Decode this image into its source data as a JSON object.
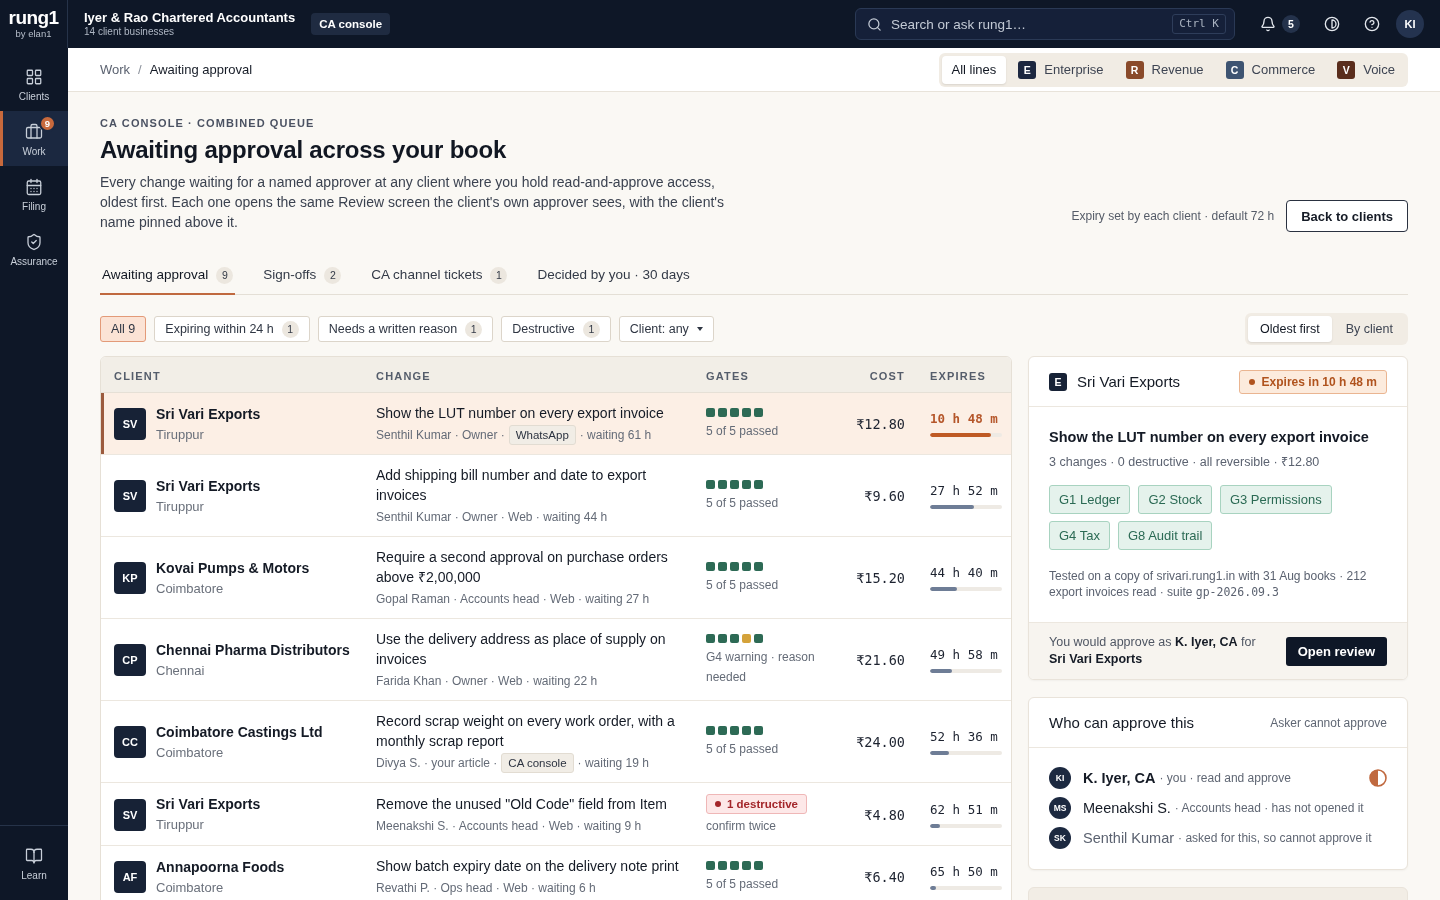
{
  "top_bar": {
    "logo": "rung1",
    "logo_sub": "by elan1",
    "firm": "Iyer & Rao Chartered Accountants",
    "firm_sub": "14 client businesses",
    "console_badge": "CA console",
    "search": {
      "placeholder": "Search or ask rung1…",
      "shortcut": "Ctrl K"
    },
    "notifications": "5",
    "avatar": "KI"
  },
  "sidebar": {
    "items": [
      {
        "label": "Clients",
        "selected": false
      },
      {
        "label": "Work",
        "selected": true,
        "badge": "9"
      },
      {
        "label": "Filing",
        "selected": false
      },
      {
        "label": "Assurance",
        "selected": false
      }
    ],
    "footer": {
      "label": "Learn"
    }
  },
  "breadcrumb": {
    "items": [
      "Work",
      "Awaiting approval"
    ],
    "separator": "/"
  },
  "lines": [
    {
      "label": "All lines",
      "selected": true
    },
    {
      "label": "Enterprise",
      "tile": "E",
      "color": "#1c2740",
      "selected": false
    },
    {
      "label": "Revenue",
      "tile": "R",
      "color": "#8a4a2a",
      "selected": false
    },
    {
      "label": "Commerce",
      "tile": "C",
      "color": "#3e5472",
      "selected": false
    },
    {
      "label": "Voice",
      "tile": "V",
      "color": "#5a2d1c",
      "selected": false
    }
  ],
  "header": {
    "eyebrow": "CA CONSOLE · COMBINED QUEUE",
    "title": "Awaiting approval across your book",
    "description": "Every change waiting for a named approver at any client where you hold read-and-approve access, oldest first. Each one opens the same Review screen the client's own approver sees, with the client's name pinned above it.",
    "expiry_note": "Expiry set by each client · default 72 h",
    "back_button": "Back to clients"
  },
  "tabs": [
    {
      "label": "Awaiting approval",
      "count": "9",
      "selected": true
    },
    {
      "label": "Sign-offs",
      "count": "2",
      "selected": false
    },
    {
      "label": "CA channel tickets",
      "count": "1",
      "selected": false
    },
    {
      "label": "Decided by you · 30 days",
      "selected": false
    }
  ],
  "filters": [
    {
      "kind": "chip",
      "label": "All 9",
      "selected": true
    },
    {
      "kind": "chip",
      "label": "Expiring within 24 h",
      "count": "1",
      "selected": false
    },
    {
      "kind": "chip",
      "label": "Needs a written reason",
      "count": "1",
      "selected": false
    },
    {
      "kind": "chip",
      "label": "Destructive",
      "count": "1",
      "selected": false
    },
    {
      "kind": "dropdown",
      "label": "Client: any",
      "selected": false
    }
  ],
  "sort": [
    {
      "label": "Oldest first",
      "selected": true
    },
    {
      "label": "By client",
      "selected": false
    }
  ],
  "table": {
    "columns": [
      "CLIENT",
      "CHANGE",
      "GATES",
      "COST",
      "EXPIRES"
    ],
    "rows": [
      {
        "initials": "SV",
        "client": "Sri Vari Exports",
        "city": "Tiruppur",
        "title": "Show the LUT number on every export invoice",
        "meta": [
          {
            "kind": "text",
            "text": "Senthil Kumar · Owner ·"
          },
          {
            "kind": "tag",
            "text": "WhatsApp"
          },
          {
            "kind": "text",
            "text": "· waiting 61 h"
          }
        ],
        "gates": {
          "kind": "squares",
          "squares": [
            {
              "color": "#2d6a55"
            },
            {
              "color": "#2d6a55"
            },
            {
              "color": "#2d6a55"
            },
            {
              "color": "#2d6a55"
            },
            {
              "color": "#2d6a55"
            }
          ],
          "note": "5 of 5 passed"
        },
        "cost": "₹12.80",
        "expires": "10 h 48 m",
        "level": 0.85,
        "urgent": true,
        "selected": true
      },
      {
        "initials": "SV",
        "client": "Sri Vari Exports",
        "city": "Tiruppur",
        "title": "Add shipping bill number and date to export invoices",
        "meta": [
          {
            "kind": "text",
            "text": "Senthil Kumar · Owner · Web · waiting 44 h"
          }
        ],
        "gates": {
          "kind": "squares",
          "squares": [
            {
              "color": "#2d6a55"
            },
            {
              "color": "#2d6a55"
            },
            {
              "color": "#2d6a55"
            },
            {
              "color": "#2d6a55"
            },
            {
              "color": "#2d6a55"
            }
          ],
          "note": "5 of 5 passed"
        },
        "cost": "₹9.60",
        "expires": "27 h 52 m",
        "level": 0.61,
        "urgent": false,
        "selected": false
      },
      {
        "initials": "KP",
        "client": "Kovai Pumps & Motors",
        "city": "Coimbatore",
        "title": "Require a second approval on purchase orders above ₹2,00,000",
        "meta": [
          {
            "kind": "text",
            "text": "Gopal Raman · Accounts head · Web · waiting 27 h"
          }
        ],
        "gates": {
          "kind": "squares",
          "squares": [
            {
              "color": "#2d6a55"
            },
            {
              "color": "#2d6a55"
            },
            {
              "color": "#2d6a55"
            },
            {
              "color": "#2d6a55"
            },
            {
              "color": "#2d6a55"
            }
          ],
          "note": "5 of 5 passed"
        },
        "cost": "₹15.20",
        "expires": "44 h 40 m",
        "level": 0.38,
        "urgent": false,
        "selected": false
      },
      {
        "initials": "CP",
        "client": "Chennai Pharma Distributors",
        "city": "Chennai",
        "title": "Use the delivery address as place of supply on invoices",
        "meta": [
          {
            "kind": "text",
            "text": "Farida Khan · Owner · Web · waiting 22 h"
          }
        ],
        "gates": {
          "kind": "squares",
          "squares": [
            {
              "color": "#2d6a55"
            },
            {
              "color": "#2d6a55"
            },
            {
              "color": "#2d6a55"
            },
            {
              "color": "#d4a23a"
            },
            {
              "color": "#2d6a55"
            }
          ],
          "note": "G4 warning · reason needed"
        },
        "cost": "₹21.60",
        "expires": "49 h 58 m",
        "level": 0.31,
        "urgent": false,
        "selected": false
      },
      {
        "initials": "CC",
        "client": "Coimbatore Castings Ltd",
        "city": "Coimbatore",
        "title": "Record scrap weight on every work order, with a monthly scrap report",
        "meta": [
          {
            "kind": "text",
            "text": "Divya S. · your article ·"
          },
          {
            "kind": "tag",
            "text": "CA console"
          },
          {
            "kind": "text",
            "text": "· waiting 19 h"
          }
        ],
        "gates": {
          "kind": "squares",
          "squares": [
            {
              "color": "#2d6a55"
            },
            {
              "color": "#2d6a55"
            },
            {
              "color": "#2d6a55"
            },
            {
              "color": "#2d6a55"
            },
            {
              "color": "#2d6a55"
            }
          ],
          "note": "5 of 5 passed"
        },
        "cost": "₹24.00",
        "expires": "52 h 36 m",
        "level": 0.27,
        "urgent": false,
        "selected": false
      },
      {
        "initials": "SV",
        "client": "Sri Vari Exports",
        "city": "Tiruppur",
        "title": "Remove the unused \"Old Code\" field from Item",
        "meta": [
          {
            "kind": "text",
            "text": "Meenakshi S. · Accounts head · Web · waiting 9 h"
          }
        ],
        "gates": {
          "kind": "badge",
          "badge": "1 destructive",
          "note": "confirm twice"
        },
        "cost": "₹4.80",
        "expires": "62 h 51 m",
        "level": 0.14,
        "urgent": false,
        "selected": false
      },
      {
        "initials": "AF",
        "client": "Annapoorna Foods",
        "city": "Coimbatore",
        "title": "Show batch expiry date on the delivery note print",
        "meta": [
          {
            "kind": "text",
            "text": "Revathi P. · Ops head · Web · waiting 6 h"
          }
        ],
        "gates": {
          "kind": "squares",
          "squares": [
            {
              "color": "#2d6a55"
            },
            {
              "color": "#2d6a55"
            },
            {
              "color": "#2d6a55"
            },
            {
              "color": "#2d6a55"
            },
            {
              "color": "#2d6a55"
            }
          ],
          "note": "5 of 5 passed"
        },
        "cost": "₹6.40",
        "expires": "65 h 50 m",
        "level": 0.08,
        "urgent": false,
        "selected": false
      }
    ]
  },
  "detail": {
    "tile": "E",
    "client": "Sri Vari Exports",
    "expires_badge": "Expires in 10 h 48 m",
    "title": "Show the LUT number on every export invoice",
    "meta": "3 changes · 0 destructive · all reversible · ₹12.80",
    "gates": [
      "G1 Ledger",
      "G2 Stock",
      "G3 Permissions",
      "G4 Tax",
      "G8 Audit trail"
    ],
    "test_note": {
      "text": "Tested on a copy of srivari.rung1.in with 31 Aug books · 212 export invoices read · suite ",
      "code": "gp-2026.09.3"
    },
    "approve_note": "You would approve as **K. Iyer, CA** for **Sri Vari Exports**",
    "open_button": "Open review"
  },
  "approvers": {
    "title": "Who can approve this",
    "note": "Asker cannot approve",
    "people": [
      {
        "initials": "KI",
        "name": "K. Iyer, CA",
        "detail": "· you · read and approve",
        "kind": "you"
      },
      {
        "initials": "MS",
        "name": "Meenakshi S.",
        "detail": "· Accounts head · has not opened it",
        "kind": "approver"
      },
      {
        "initials": "SK",
        "name": "Senthil Kumar",
        "detail": "· asked for this, so cannot approve it",
        "kind": "asker"
      }
    ]
  }
}
